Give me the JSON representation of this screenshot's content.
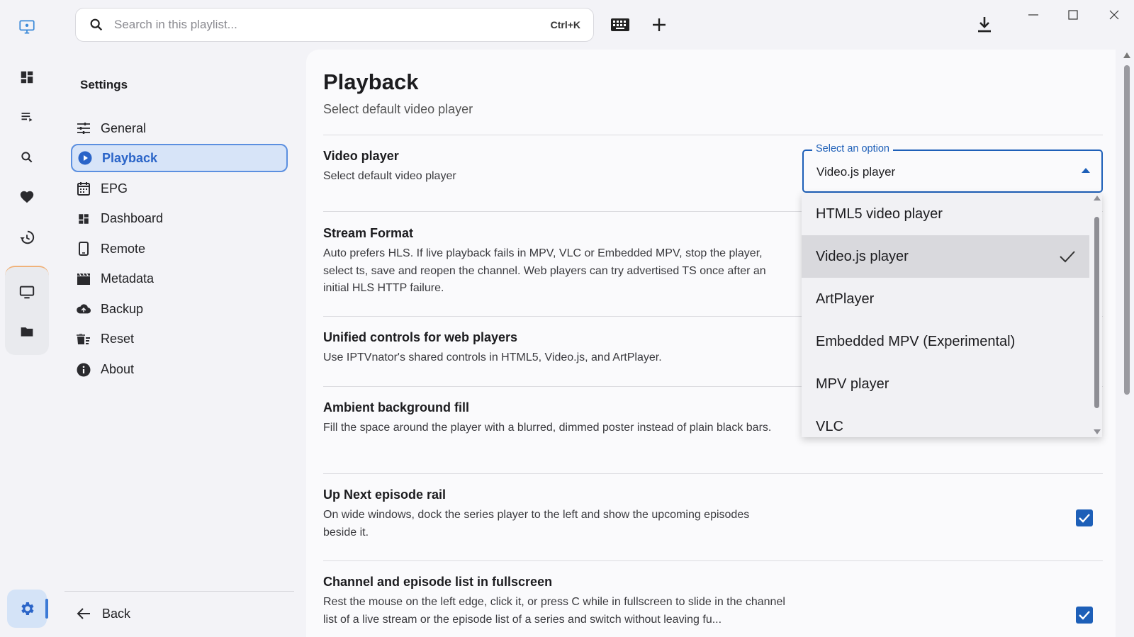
{
  "search": {
    "placeholder": "Search in this playlist...",
    "shortcut": "Ctrl+K"
  },
  "rail": {
    "items": [
      {
        "name": "app-logo-icon"
      },
      {
        "name": "dashboard-icon"
      },
      {
        "name": "playlist-icon"
      },
      {
        "name": "search-icon"
      },
      {
        "name": "favorites-icon"
      },
      {
        "name": "history-icon"
      },
      {
        "name": "tv-icon"
      },
      {
        "name": "folder-icon"
      },
      {
        "name": "settings-gear-icon"
      }
    ]
  },
  "settings_nav": {
    "title": "Settings",
    "items": [
      {
        "label": "General",
        "icon": "tune-icon"
      },
      {
        "label": "Playback",
        "icon": "play-circle-icon",
        "active": true
      },
      {
        "label": "EPG",
        "icon": "calendar-icon"
      },
      {
        "label": "Dashboard",
        "icon": "dashboard-icon"
      },
      {
        "label": "Remote",
        "icon": "phone-icon"
      },
      {
        "label": "Metadata",
        "icon": "clapperboard-icon"
      },
      {
        "label": "Backup",
        "icon": "cloud-upload-icon"
      },
      {
        "label": "Reset",
        "icon": "delete-sweep-icon"
      },
      {
        "label": "About",
        "icon": "info-icon"
      }
    ],
    "back_label": "Back"
  },
  "main": {
    "title": "Playback",
    "subtitle": "Select default video player",
    "settings": [
      {
        "title": "Video player",
        "description": "Select default video player"
      },
      {
        "title": "Stream Format",
        "description": "Auto prefers HLS. If live playback fails in MPV, VLC or Embedded MPV, stop the player, select ts, save and reopen the channel. Web players can try advertised TS once after an initial HLS HTTP failure."
      },
      {
        "title": "Unified controls for web players",
        "description": "Use IPTVnator's shared controls in HTML5, Video.js, and ArtPlayer."
      },
      {
        "title": "Ambient background fill",
        "description": "Fill the space around the player with a blurred, dimmed poster instead of plain black bars."
      },
      {
        "title": "Up Next episode rail",
        "description": "On wide windows, dock the series player to the left and show the upcoming episodes beside it.",
        "checked": true
      },
      {
        "title": "Channel and episode list in fullscreen",
        "description": "Rest the mouse on the left edge, click it, or press C while in fullscreen to slide in the channel list of a live stream or the episode list of a series and switch without leaving fu...",
        "checked": true
      }
    ]
  },
  "select": {
    "label": "Select an option",
    "value": "Video.js player",
    "options": [
      {
        "label": "HTML5 video player"
      },
      {
        "label": "Video.js player",
        "selected": true
      },
      {
        "label": "ArtPlayer"
      },
      {
        "label": "Embedded MPV (Experimental)"
      },
      {
        "label": "MPV player"
      },
      {
        "label": "VLC"
      }
    ]
  },
  "colors": {
    "accent": "#1d5fb8",
    "active_nav_bg": "#d7e4f8",
    "background": "#f3f3f7"
  }
}
